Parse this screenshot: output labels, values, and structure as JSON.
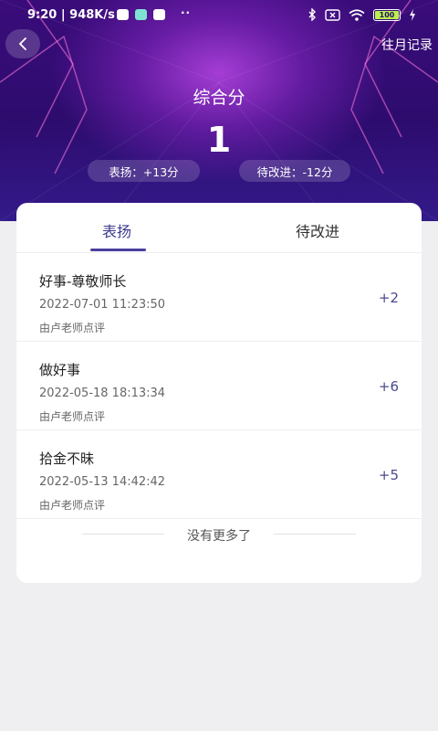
{
  "status_bar": {
    "time": "9:20",
    "speed": "948K/s",
    "battery": "100",
    "more_dots": "··"
  },
  "nav": {
    "back_icon": "chevron-left-icon",
    "history_label": "往月记录"
  },
  "summary": {
    "score_label": "综合分",
    "score_value": "1",
    "praise_pill": "表扬：+13分",
    "improve_pill": "待改进：-12分"
  },
  "tabs": [
    {
      "label": "表扬",
      "active": true
    },
    {
      "label": "待改进",
      "active": false
    }
  ],
  "records": [
    {
      "title": "好事-尊敬师长",
      "time": "2022-07-01 11:23:50",
      "reviewer": "由卢老师点评",
      "points": "+2"
    },
    {
      "title": "做好事",
      "time": "2022-05-18 18:13:34",
      "reviewer": "由卢老师点评",
      "points": "+6"
    },
    {
      "title": "拾金不昧",
      "time": "2022-05-13 14:42:42",
      "reviewer": "由卢老师点评",
      "points": "+5"
    }
  ],
  "list_footer": "没有更多了",
  "colors": {
    "header_dark": "#2d0c6e",
    "header_glow": "#b946e6",
    "accent": "#4a3f9e",
    "page_bg": "#efeff1"
  }
}
